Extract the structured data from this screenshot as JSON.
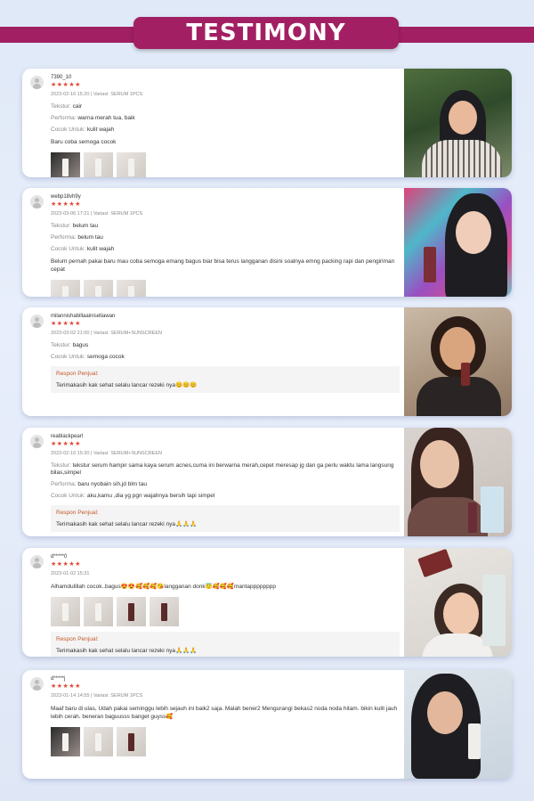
{
  "title": "TESTIMONY",
  "reviews": [
    {
      "user": "7390_10",
      "stars": "★★★★★",
      "date": "2023-02-16 15:20 | Variasi: SERUM 1PCS",
      "attrs": [
        {
          "label": "Tekstur:",
          "value": "cair"
        },
        {
          "label": "Performa:",
          "value": "warna merah tua, baik"
        },
        {
          "label": "Cocok Untuk:",
          "value": "kulit wajah"
        }
      ],
      "text": "Baru coba semoga cocok"
    },
    {
      "user": "webp18vh9y",
      "stars": "★★★★★",
      "date": "2023-03-06 17:21 | Variasi: SERUM 1PCS",
      "attrs": [
        {
          "label": "Tekstur:",
          "value": "belum tau"
        },
        {
          "label": "Performa:",
          "value": "belum tau"
        },
        {
          "label": "Cocok Untuk:",
          "value": "kulit wajah"
        }
      ],
      "text": "Belum pernah pakai baru mau coba semoga emang bagus biar bisa terus langganan disini soalnya emng packing rapi dan pengiriman cepat"
    },
    {
      "user": "milannishabillaainisetiawan",
      "stars": "★★★★★",
      "date": "2023-03-02 21:00 | Variasi: SERUM+SUNSCREEN",
      "attrs": [
        {
          "label": "Tekstur:",
          "value": "bagus"
        },
        {
          "label": "Cocok Untuk:",
          "value": "semoga cocok"
        }
      ],
      "response_label": "Respon Penjual:",
      "response_text": "Terimakasih kak sehat selalu lancar rezeki nya😊😊😊"
    },
    {
      "user": "reablackpearl",
      "stars": "★★★★★",
      "date": "2023-02-10 15:30 | Variasi: SERUM+SUNSCREEN",
      "attrs": [
        {
          "label": "Tekstur:",
          "value": "tekstur serum hampir sama kaya serum acnes,cuma ini berwarna merah,cepet meresap jg dan ga perlu waktu lama langsung bilas,simpel"
        },
        {
          "label": "Performa:",
          "value": "baru nyobain sih,jd blm tau"
        },
        {
          "label": "Cocok Untuk:",
          "value": "aku,kamu ,dia yg pgn wajahnya bersih tapi simpel"
        }
      ],
      "response_label": "Respon Penjual:",
      "response_text": "Terimakasih kak sehat selalu lancar rezeki nya🙏🙏🙏"
    },
    {
      "user": "d*****0",
      "stars": "★★★★★",
      "date": "2023-01-02 15:31",
      "text": "Alhamdulillah cocok..bagus😍😍🥰🥰🥰😘langganan donk😇🥰🥰🥰mantapppppppp",
      "response_label": "Respon Penjual:",
      "response_text": "Terimakasih kak sehat selalu lancar rezeki nya🙏🙏🙏"
    },
    {
      "user": "d*****j",
      "stars": "★★★★★",
      "date": "2023-01-14 14:55 | Variasi: SERUM 1PCS",
      "text": "Maaf baru di ulas, Udah pakai seminggu lebih sejauh ini baik2 saja. Malah bener2 Mengurangi bekas2 noda noda hitam. bikin kulit jauh lebih cerah. beneran baguusss banget guyss🥰"
    }
  ]
}
